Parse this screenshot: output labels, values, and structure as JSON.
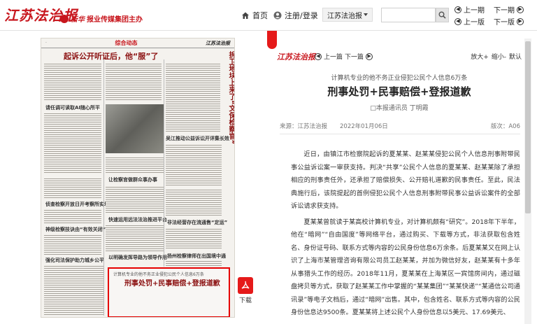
{
  "header": {
    "logo": "江苏法治报",
    "sub_brand": "新华",
    "sub_text": "报业传媒集团主办",
    "nav_home": "首页",
    "nav_login": "注册/登录",
    "edition_selected": "江苏法治报",
    "search_placeholder": "",
    "prev_period": "上一期",
    "next_period": "下一期",
    "prev_page": "上一版",
    "next_page": "下一版"
  },
  "icons": {
    "home": "home-icon",
    "user": "user-icon",
    "search": "search-icon",
    "pdf": "pdf-icon"
  },
  "newspaper": {
    "section": "综合动态",
    "masthead": "江苏法治报",
    "headline1": "起诉公开听证后，他“服”了",
    "vertical_headline": "拆卫地块上来了“文保检察官”",
    "headline_highlight_sub": "计算机专业的他不务正业侵犯公民个人信息6万条",
    "headline_highlight": "刑事处罚+民事赔偿+登报道歉",
    "pdf_label": "下载",
    "col_titles": [
      "请任调可读取AI随心所平",
      "吴江推动公益诉讼开评集长效",
      "让检察官做群众事办事",
      "侦查检察开放日开考察所实境",
      "神级检察技诀由“有效关闭”",
      "强化司法保护助力城乡公平",
      "快速运用远法法治推进平台",
      "非法经营存在流通售“定运”",
      "扬州检察律师在出国境中通",
      "以明确发挥导路为领导作用"
    ]
  },
  "article": {
    "logo": "江苏法治报",
    "prev": "上一篇",
    "next": "下一篇",
    "zoom_in": "放大+",
    "zoom_out": "缩小-",
    "zoom_default": "默认",
    "kicker": "计算机专业的他不务正业侵犯公民个人信息6万条",
    "title": "刑事处罚+民事赔偿+登报道歉",
    "byline": "□本报通讯员 丁明霞",
    "source": "来源：江苏法治报",
    "date": "2022年01月06日",
    "edition": "版次：A06",
    "paragraphs": [
      "近日，由镇江市检察院起诉的夏某某、赵某某侵犯公民个人信息刑事附带民事公益诉讼案一审获支持。判决“共享”公民个人信息的夏某某、赵某某除了承担相应的刑事责任外，还承担了赔偿损失、公开赔礼道歉的民事责任。至此，民法典施行后，该院提起的首例侵犯公民个人信息刑事附带民事公益诉讼案件的全部诉讼请求获支持。",
      "夏某某曾就读于某高校计算机专业，对计算机颇有“研究”。2018年下半年，他在“暗网”“自由国度”等网络平台，通过购买、下载等方式，非法获取包含姓名、身份证号码、联系方式等内容的公民身份信息6万余条。后夏某某又在网上认识了上海市某管理咨询有限公司员工赵某某，并加为微信好友，赵某某有十多年从事猎头工作的经历。2018年11月，夏某某在上海某区一宾馆房间内，通过磁盘拷贝等方式，获取了赵某某工作中掌握的“某某集团”“某某快递”“某通信公司通讯录”等电子文档后，通过“暗网”出售。其中，包含姓名、联系方式等内容的公民身份信息达9500条。夏某某将上述公民个人身份信息以5美元、17.69美元、"
    ]
  }
}
